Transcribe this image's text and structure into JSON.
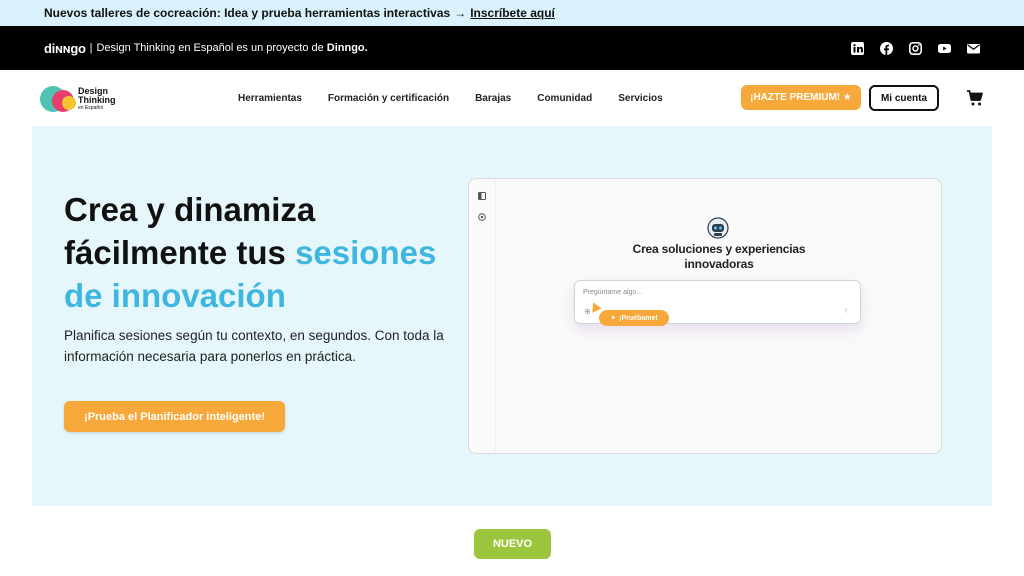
{
  "announcement": {
    "text": "Nuevos talleres de cocreación: Idea y prueba herramientas interactivas",
    "arrow": "→",
    "link": "Inscríbete aquí"
  },
  "topbar": {
    "logo": "diɴɴgo",
    "separator": "|",
    "text": "Design Thinking en Español es un proyecto de",
    "brand": "Dinngo.",
    "social_icons": [
      "linkedin-icon",
      "facebook-icon",
      "instagram-icon",
      "youtube-icon",
      "email-icon"
    ]
  },
  "nav": {
    "logo_line1": "Design",
    "logo_line2": "Thinking",
    "logo_line3": "en Español",
    "items": [
      "Herramientas",
      "Formación y certificación",
      "Barajas",
      "Comunidad",
      "Servicios"
    ],
    "premium": "¡HAZTE PREMIUM! ★",
    "account": "Mi cuenta"
  },
  "hero": {
    "title_part1": "Crea y dinamiza fácilmente tus",
    "title_accent": "sesiones de innovación",
    "subtitle": "Planifica sesiones según tu contexto, en segundos. Con toda la información necesaria para ponerlos en práctica.",
    "cta": "¡Prueba el Planificador inteligente!"
  },
  "mockup": {
    "title": "Crea soluciones y experiencias innovadoras",
    "placeholder": "Pregúntame algo...",
    "plus": "⊕",
    "send": "↑",
    "pill_icon": "✦",
    "pill": "¡Pruébame!"
  },
  "badge": "NUEVO",
  "colors": {
    "accent_blue": "#3fb6e0",
    "orange": "#f7a83a",
    "green": "#9bc53d",
    "hero_bg": "#e6f7fb"
  }
}
